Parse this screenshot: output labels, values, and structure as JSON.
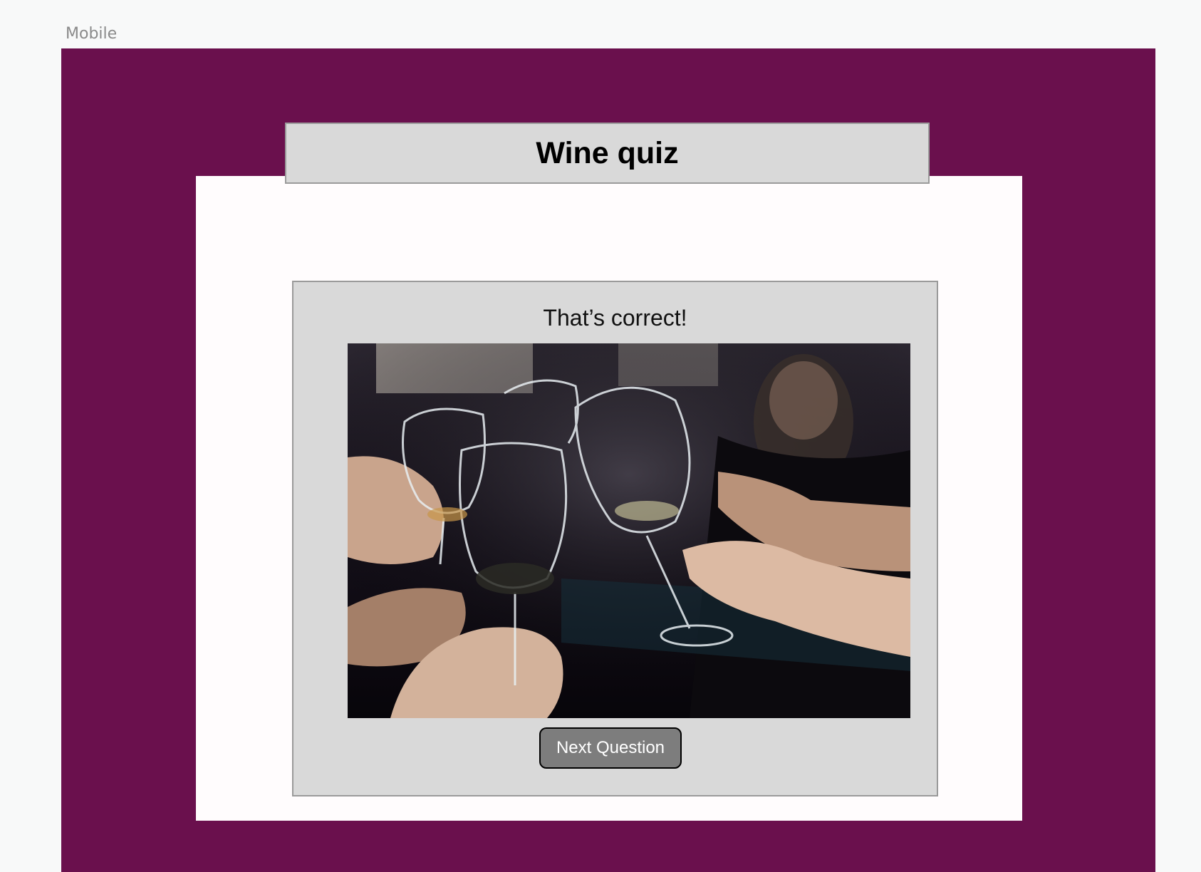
{
  "artboard": {
    "label": "Mobile"
  },
  "quiz": {
    "title": "Wine quiz",
    "result_text": "That’s correct!",
    "next_button_label": "Next Question"
  },
  "colors": {
    "artboard_background": "#6a104d",
    "panel_background": "#d9d9d9",
    "button_background": "#7d7d7d"
  },
  "image": {
    "subject": "hands toasting with wine glasses"
  }
}
